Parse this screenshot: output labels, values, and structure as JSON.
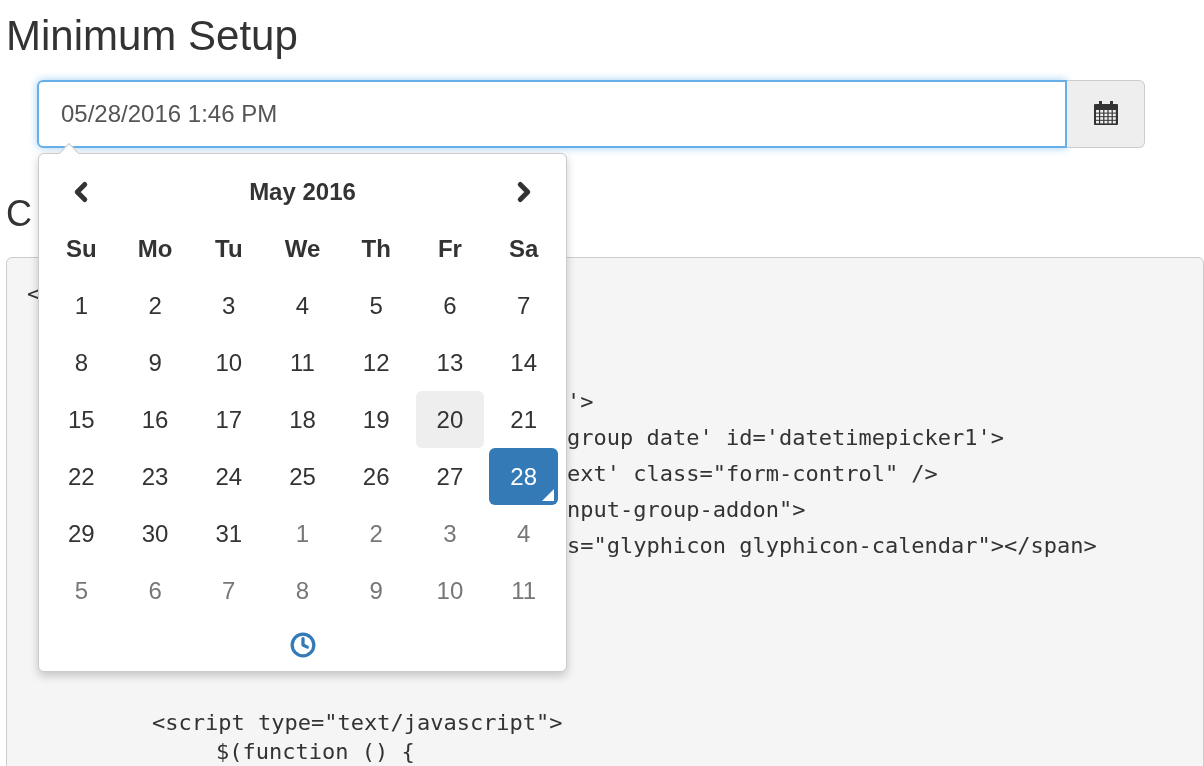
{
  "title": "Minimum Setup",
  "datetime_input": {
    "value": "05/28/2016 1:46 PM"
  },
  "picker": {
    "month": "May 2016",
    "weekdays": [
      "Su",
      "Mo",
      "Tu",
      "We",
      "Th",
      "Fr",
      "Sa"
    ],
    "weeks": [
      [
        {
          "day": "1",
          "muted": false,
          "selected": false,
          "highlighted": false,
          "today": false
        },
        {
          "day": "2",
          "muted": false,
          "selected": false,
          "highlighted": false,
          "today": false
        },
        {
          "day": "3",
          "muted": false,
          "selected": false,
          "highlighted": false,
          "today": false
        },
        {
          "day": "4",
          "muted": false,
          "selected": false,
          "highlighted": false,
          "today": false
        },
        {
          "day": "5",
          "muted": false,
          "selected": false,
          "highlighted": false,
          "today": false
        },
        {
          "day": "6",
          "muted": false,
          "selected": false,
          "highlighted": false,
          "today": false
        },
        {
          "day": "7",
          "muted": false,
          "selected": false,
          "highlighted": false,
          "today": false
        }
      ],
      [
        {
          "day": "8",
          "muted": false,
          "selected": false,
          "highlighted": false,
          "today": false
        },
        {
          "day": "9",
          "muted": false,
          "selected": false,
          "highlighted": false,
          "today": false
        },
        {
          "day": "10",
          "muted": false,
          "selected": false,
          "highlighted": false,
          "today": false
        },
        {
          "day": "11",
          "muted": false,
          "selected": false,
          "highlighted": false,
          "today": false
        },
        {
          "day": "12",
          "muted": false,
          "selected": false,
          "highlighted": false,
          "today": false
        },
        {
          "day": "13",
          "muted": false,
          "selected": false,
          "highlighted": false,
          "today": false
        },
        {
          "day": "14",
          "muted": false,
          "selected": false,
          "highlighted": false,
          "today": false
        }
      ],
      [
        {
          "day": "15",
          "muted": false,
          "selected": false,
          "highlighted": false,
          "today": false
        },
        {
          "day": "16",
          "muted": false,
          "selected": false,
          "highlighted": false,
          "today": false
        },
        {
          "day": "17",
          "muted": false,
          "selected": false,
          "highlighted": false,
          "today": false
        },
        {
          "day": "18",
          "muted": false,
          "selected": false,
          "highlighted": false,
          "today": false
        },
        {
          "day": "19",
          "muted": false,
          "selected": false,
          "highlighted": false,
          "today": false
        },
        {
          "day": "20",
          "muted": false,
          "selected": false,
          "highlighted": true,
          "today": false
        },
        {
          "day": "21",
          "muted": false,
          "selected": false,
          "highlighted": false,
          "today": false
        }
      ],
      [
        {
          "day": "22",
          "muted": false,
          "selected": false,
          "highlighted": false,
          "today": false
        },
        {
          "day": "23",
          "muted": false,
          "selected": false,
          "highlighted": false,
          "today": false
        },
        {
          "day": "24",
          "muted": false,
          "selected": false,
          "highlighted": false,
          "today": false
        },
        {
          "day": "25",
          "muted": false,
          "selected": false,
          "highlighted": false,
          "today": false
        },
        {
          "day": "26",
          "muted": false,
          "selected": false,
          "highlighted": false,
          "today": false
        },
        {
          "day": "27",
          "muted": false,
          "selected": false,
          "highlighted": false,
          "today": false
        },
        {
          "day": "28",
          "muted": false,
          "selected": true,
          "highlighted": false,
          "today": true
        }
      ],
      [
        {
          "day": "29",
          "muted": false,
          "selected": false,
          "highlighted": false,
          "today": false
        },
        {
          "day": "30",
          "muted": false,
          "selected": false,
          "highlighted": false,
          "today": false
        },
        {
          "day": "31",
          "muted": false,
          "selected": false,
          "highlighted": false,
          "today": false
        },
        {
          "day": "1",
          "muted": true,
          "selected": false,
          "highlighted": false,
          "today": false
        },
        {
          "day": "2",
          "muted": true,
          "selected": false,
          "highlighted": false,
          "today": false
        },
        {
          "day": "3",
          "muted": true,
          "selected": false,
          "highlighted": false,
          "today": false
        },
        {
          "day": "4",
          "muted": true,
          "selected": false,
          "highlighted": false,
          "today": false
        }
      ],
      [
        {
          "day": "5",
          "muted": true,
          "selected": false,
          "highlighted": false,
          "today": false
        },
        {
          "day": "6",
          "muted": true,
          "selected": false,
          "highlighted": false,
          "today": false
        },
        {
          "day": "7",
          "muted": true,
          "selected": false,
          "highlighted": false,
          "today": false
        },
        {
          "day": "8",
          "muted": true,
          "selected": false,
          "highlighted": false,
          "today": false
        },
        {
          "day": "9",
          "muted": true,
          "selected": false,
          "highlighted": false,
          "today": false
        },
        {
          "day": "10",
          "muted": true,
          "selected": false,
          "highlighted": false,
          "today": false
        },
        {
          "day": "11",
          "muted": true,
          "selected": false,
          "highlighted": false,
          "today": false
        }
      ]
    ]
  },
  "code_heading": "C",
  "code_lines": [
    {
      "kind": "left",
      "text": "<"
    },
    {
      "kind": "blank"
    },
    {
      "kind": "blank"
    },
    {
      "kind": "right",
      "text": "'>"
    },
    {
      "kind": "right",
      "text": "group date' id='datetimepicker1'>"
    },
    {
      "kind": "right",
      "text": "ext' class=\"form-control\" />"
    },
    {
      "kind": "right",
      "text": "nput-group-addon\">"
    },
    {
      "kind": "right",
      "text": "s=\"glyphicon glyphicon-calendar\"></span>"
    },
    {
      "kind": "blank"
    },
    {
      "kind": "blank"
    },
    {
      "kind": "blank"
    },
    {
      "kind": "blank"
    },
    {
      "kind": "indented",
      "text": "<script type=\"text/javascript\">"
    },
    {
      "kind": "nested",
      "text": "$(function () {"
    }
  ]
}
